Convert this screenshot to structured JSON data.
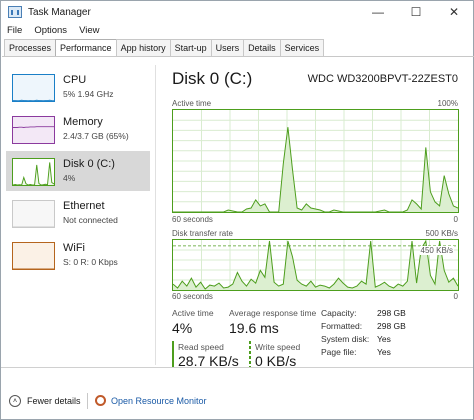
{
  "window": {
    "title": "Task Manager",
    "controls": [
      "—",
      "☐",
      "✕"
    ]
  },
  "menu": [
    "File",
    "Options",
    "View"
  ],
  "tabs": [
    "Processes",
    "Performance",
    "App history",
    "Start-up",
    "Users",
    "Details",
    "Services"
  ],
  "active_tab": "Performance",
  "sidebar": [
    {
      "name": "CPU",
      "sub": "5%  1.94 GHz",
      "color": "#1a7fc7",
      "fill": "#eef6fc"
    },
    {
      "name": "Memory",
      "sub": "2.4/3.7 GB (65%)",
      "color": "#8b3a9e",
      "fill": "#f3e8f6"
    },
    {
      "name": "Disk 0 (C:)",
      "sub": "4%",
      "color": "#4d9e1d",
      "fill": "#f0f8ea",
      "selected": true
    },
    {
      "name": "Ethernet",
      "sub": "Not connected",
      "color": "#c9c9c9",
      "fill": "#f7f7f7"
    },
    {
      "name": "WiFi",
      "sub": "S: 0  R: 0 Kbps",
      "color": "#b5651d",
      "fill": "#fbf1e6"
    }
  ],
  "disk": {
    "title": "Disk 0 (C:)",
    "model": "WDC WD3200BPVT-22ZEST0",
    "active_time_label": "Active time",
    "active_time_max": "100%",
    "active_time_span": "60 seconds",
    "active_time_min": "0",
    "transfer_label": "Disk transfer rate",
    "transfer_max": "500 KB/s",
    "transfer_mid": "450 KB/s",
    "transfer_span": "60 seconds",
    "transfer_min": "0",
    "active_time_pct": [
      0,
      0,
      0,
      0,
      0,
      0,
      0,
      0,
      0,
      0,
      0,
      0,
      2,
      1,
      0,
      0,
      3,
      4,
      12,
      6,
      8,
      0,
      0,
      0,
      48,
      84,
      42,
      4,
      2,
      8,
      4,
      3,
      2,
      0,
      0,
      2,
      1,
      0,
      0,
      0,
      0,
      0,
      0,
      0,
      0,
      1,
      2,
      0,
      0,
      0,
      0,
      2,
      12,
      8,
      3,
      64,
      20,
      10,
      6,
      36,
      18,
      6,
      4
    ],
    "transfer_kbps": [
      60,
      20,
      90,
      40,
      120,
      30,
      80,
      10,
      50,
      40,
      70,
      20,
      30,
      60,
      180,
      90,
      40,
      110,
      70,
      200,
      130,
      500,
      80,
      40,
      60,
      500,
      340,
      100,
      60,
      40,
      90,
      30,
      50,
      40,
      20,
      60,
      120,
      70,
      30,
      20,
      40,
      90,
      60,
      500,
      30,
      50,
      80,
      40,
      20,
      60,
      40,
      90,
      500,
      70,
      420,
      500,
      150,
      60,
      500,
      200,
      80,
      120,
      40
    ]
  },
  "stats": {
    "active_time_label": "Active time",
    "active_time": "4%",
    "avg_response_label": "Average response time",
    "avg_response": "19.6 ms",
    "read_label": "Read speed",
    "read": "28.7 KB/s",
    "write_label": "Write speed",
    "write": "0 KB/s"
  },
  "properties": [
    {
      "key": "Capacity:",
      "value": "298 GB"
    },
    {
      "key": "Formatted:",
      "value": "298 GB"
    },
    {
      "key": "System disk:",
      "value": "Yes"
    },
    {
      "key": "Page file:",
      "value": "Yes"
    }
  ],
  "footer": {
    "fewer_details": "Fewer details",
    "resource_monitor": "Open Resource Monitor"
  }
}
